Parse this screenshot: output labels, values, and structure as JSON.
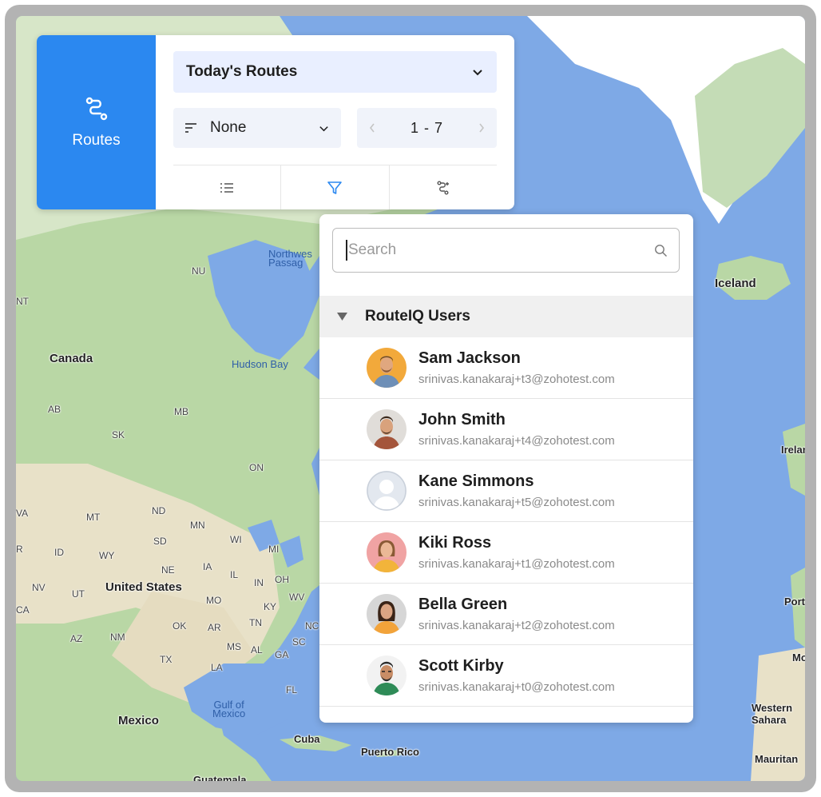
{
  "routes_tile": {
    "label": "Routes",
    "icon": "route-icon"
  },
  "route_select": {
    "value": "Today's Routes"
  },
  "sort": {
    "value": "None"
  },
  "pager": {
    "range": "1 - 7"
  },
  "toolbar": {
    "icons": [
      "list-icon",
      "filter-icon",
      "route-settings-icon"
    ],
    "active": "filter-icon"
  },
  "search": {
    "placeholder": "Search",
    "value": ""
  },
  "group": {
    "label": "RouteIQ Users"
  },
  "users": [
    {
      "name": "Sam Jackson",
      "email": "srinivas.kanakaraj+t3@zohotest.com",
      "avatar_bg": "#f2a93b"
    },
    {
      "name": "John Smith",
      "email": "srinivas.kanakaraj+t4@zohotest.com",
      "avatar_bg": "#e0ddd9"
    },
    {
      "name": "Kane Simmons",
      "email": "srinivas.kanakaraj+t5@zohotest.com",
      "avatar_bg": "#e3e8ef"
    },
    {
      "name": "Kiki Ross",
      "email": "srinivas.kanakaraj+t1@zohotest.com",
      "avatar_bg": "#f0a3a3"
    },
    {
      "name": "Bella Green",
      "email": "srinivas.kanakaraj+t2@zohotest.com",
      "avatar_bg": "#d6d6d6"
    },
    {
      "name": "Scott Kirby",
      "email": "srinivas.kanakaraj+t0@zohotest.com",
      "avatar_bg": "#f2f2f2"
    }
  ],
  "map": {
    "labels": {
      "canada": "Canada",
      "iceland": "Iceland",
      "ireland": "Irelan",
      "portugal": "Portu",
      "morocco": "Mo",
      "western_sahara": "Western\nSahara",
      "mauritania": "Mauritan",
      "united_states": "United States",
      "mexico": "Mexico",
      "cuba": "Cuba",
      "puerto_rico": "Puerto Rico",
      "guatemala": "Guatemala",
      "hudson_bay": "Hudson Bay",
      "northwest_passage": "Northwes\nPassag",
      "gulf_of_mexico": "Gulf of\nMexico",
      "nu": "NU",
      "nt": "NT",
      "ab": "AB",
      "sk": "SK",
      "mb": "MB",
      "on": "ON",
      "wa": "VA",
      "mt": "MT",
      "nd": "ND",
      "mn": "MN",
      "wi": "WI",
      "mi": "MI",
      "sd": "SD",
      "id": "ID",
      "wy": "WY",
      "ne": "NE",
      "ia": "IA",
      "il": "IL",
      "in": "IN",
      "oh": "OH",
      "nv": "NV",
      "ut": "UT",
      "co": "CA",
      "mo": "MO",
      "ky": "KY",
      "wv": "WV",
      "ok": "OK",
      "ar": "AR",
      "tn": "TN",
      "nc": "NC",
      "az": "AZ",
      "nm": "NM",
      "ms": "MS",
      "al": "AL",
      "ga": "GA",
      "sc": "SC",
      "tx": "TX",
      "la": "LA",
      "fl": "FL",
      "or": "R"
    }
  }
}
